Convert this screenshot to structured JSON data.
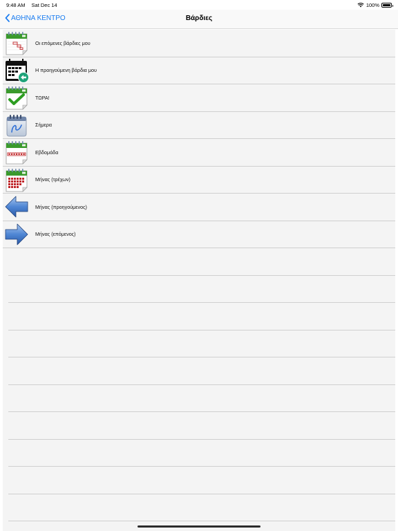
{
  "status_bar": {
    "time": "9:48 AM",
    "date": "Sat Dec 14",
    "battery": "100%",
    "battery_level": 1.0
  },
  "nav": {
    "back_label": "ΑΘΗΝΑ ΚΕΝΤΡΟ",
    "title": "Βάρδιες"
  },
  "menu": [
    {
      "label": "Οι επόμενες βάρδιες μου",
      "icon": "calendar-next-shifts-icon"
    },
    {
      "label": "Η προηγούμενη βάρδια μου",
      "icon": "calendar-previous-shift-icon"
    },
    {
      "label": "ΤΩΡΑ!",
      "icon": "calendar-checkmark-icon"
    },
    {
      "label": "Σήμερα",
      "icon": "notepad-today-icon"
    },
    {
      "label": "Εβδομάδα",
      "icon": "calendar-week-icon"
    },
    {
      "label": "Μήνας (τρέχων)",
      "icon": "calendar-month-icon"
    },
    {
      "label": "Μήνας (προηγούμενος)",
      "icon": "arrow-left-icon"
    },
    {
      "label": "Μήνας (επόμενος)",
      "icon": "arrow-right-icon"
    }
  ]
}
